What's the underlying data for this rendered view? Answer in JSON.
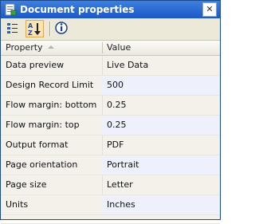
{
  "window": {
    "title": "Document properties",
    "icon": "document-properties-icon"
  },
  "toolbar": {
    "buttons": [
      {
        "name": "categorized-view-button",
        "icon": "categorized-list-icon",
        "active": false
      },
      {
        "name": "alphabetical-sort-button",
        "icon": "sort-az-icon",
        "active": true
      },
      {
        "name": "property-info-button",
        "icon": "info-icon",
        "active": false
      }
    ]
  },
  "grid": {
    "headers": {
      "property": "Property",
      "value": "Value"
    },
    "rows": [
      {
        "property": "Data preview",
        "value": "Live Data"
      },
      {
        "property": "Design Record Limit",
        "value": "500"
      },
      {
        "property": "Flow margin: bottom",
        "value": "0.25"
      },
      {
        "property": "Flow margin: top",
        "value": "0.25"
      },
      {
        "property": "Output format",
        "value": "PDF"
      },
      {
        "property": "Page orientation",
        "value": "Portrait"
      },
      {
        "property": "Page size",
        "value": "Letter"
      },
      {
        "property": "Units",
        "value": "Inches"
      },
      {
        "property": "",
        "value": ""
      }
    ]
  },
  "colors": {
    "titlebar": "#1c58c6",
    "value_alt_row": "#eef1fb",
    "active_button": "#f8e4b7"
  }
}
